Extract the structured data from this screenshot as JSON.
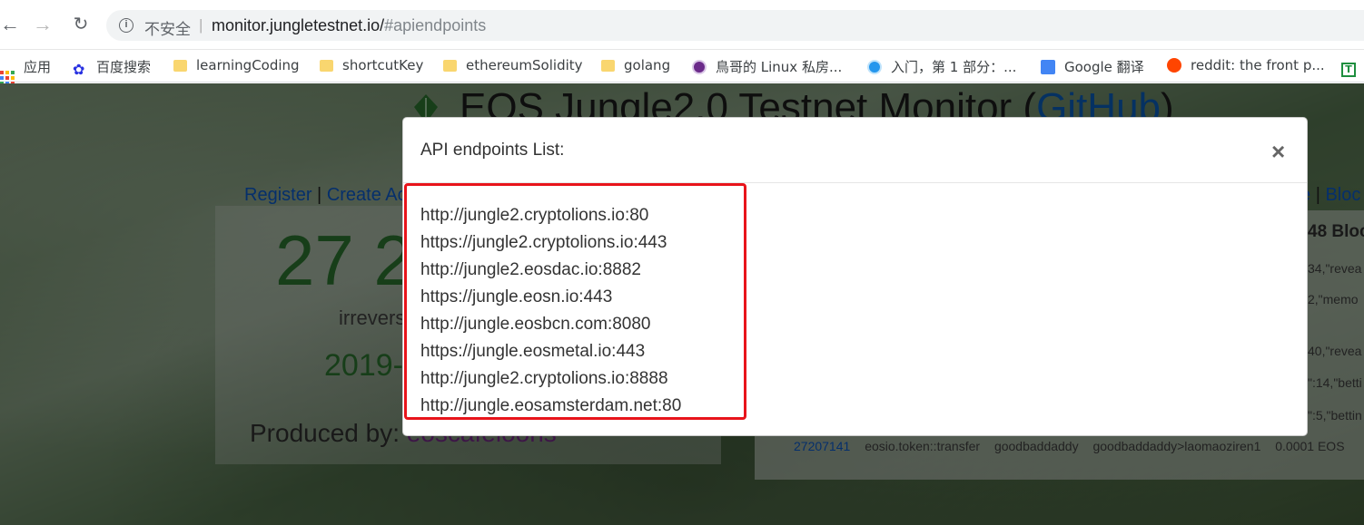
{
  "browser": {
    "security_label": "不安全",
    "separator": "|",
    "url_host": "monitor.jungletestnet.io/",
    "url_path": "#apiendpoints"
  },
  "bookmarks": [
    {
      "label": "应用",
      "icon": "apps-grid-icon"
    },
    {
      "label": "百度搜索",
      "icon": "baidu-paw-icon"
    },
    {
      "label": "learningCoding",
      "icon": "folder-icon"
    },
    {
      "label": "shortcutKey",
      "icon": "folder-icon"
    },
    {
      "label": "ethereumSolidity",
      "icon": "folder-icon"
    },
    {
      "label": "golang",
      "icon": "folder-icon"
    },
    {
      "label": "鳥哥的 Linux 私房...",
      "icon": "linux-penguin-icon"
    },
    {
      "label": "入门，第 1 部分：...",
      "icon": "docker-icon"
    },
    {
      "label": "Google 翻译",
      "icon": "google-translate-icon"
    },
    {
      "label": "reddit: the front p...",
      "icon": "reddit-icon"
    },
    {
      "label": "",
      "icon": "green-t-icon"
    }
  ],
  "background_page": {
    "title_main": "EOS Jungle2.0 Testnet Monitor (",
    "title_link": "GitHub",
    "title_end": ")",
    "links_left": {
      "register": "Register",
      "sep": "|",
      "create": "Create Ac"
    },
    "links_right": {
      "partial": "e",
      "sep": "|",
      "bloc": "Bloc"
    },
    "block_number_partial": "27 2",
    "irreversible_partial": "irrevers",
    "date_partial": "2019-",
    "produced_by_label": "Produced by:",
    "producer_partial": "eoscafeloons",
    "recent_blocks_title": "48 Bloc",
    "rows": [
      "34,\"revea",
      "2,\"memo",
      "40,\"revea",
      "\":14,\"betti",
      "\":5,\"bettin"
    ],
    "transfer_row": {
      "block": "27207141",
      "action": "eosio.token::transfer",
      "actor": "goodbaddaddy",
      "route": "goodbaddaddy>laomaoziren1",
      "amount": "0.0001 EOS"
    }
  },
  "modal": {
    "title": "API endpoints List:",
    "close_label": "×",
    "endpoints": [
      "http://jungle2.cryptolions.io:80",
      "https://jungle2.cryptolions.io:443",
      "http://jungle2.eosdac.io:8882",
      "https://jungle.eosn.io:443",
      "http://jungle.eosbcn.com:8080",
      "https://jungle.eosmetal.io:443",
      "http://jungle2.cryptolions.io:8888",
      "http://jungle.eosamsterdam.net:80"
    ]
  },
  "colors": {
    "highlight": "#e8141b",
    "link": "#0b5ed7",
    "number_green": "#2f7d32"
  }
}
